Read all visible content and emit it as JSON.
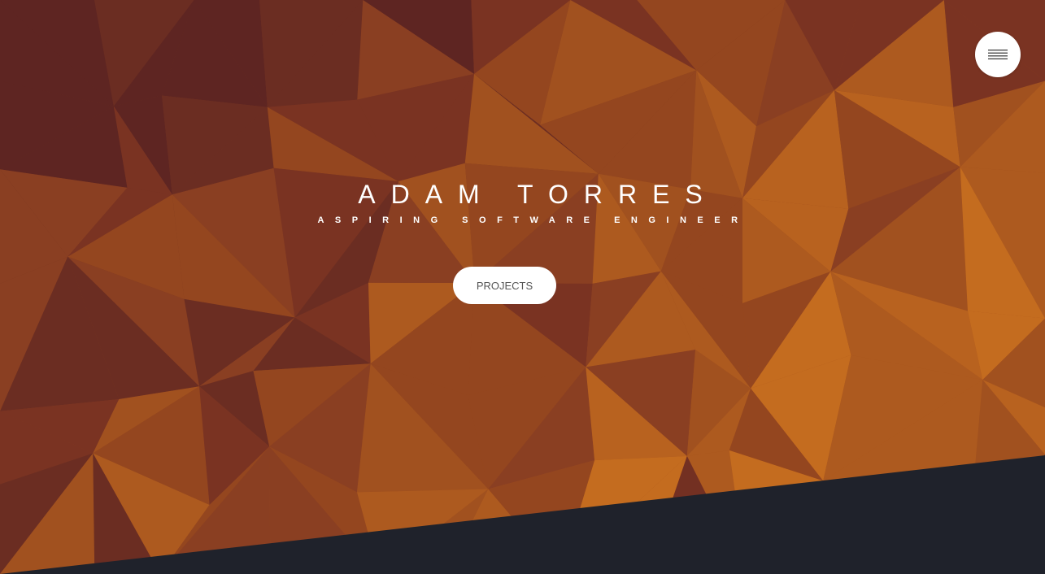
{
  "header": {
    "menu_icon": "hamburger-menu-icon"
  },
  "hero": {
    "title": "ADAM TORRES",
    "subtitle": "ASPIRING SOFTWARE ENGINEER",
    "projects_label": "PROJECTS"
  },
  "colors": {
    "accent_orange": "#b8551f",
    "dark_band": "#1f222b",
    "button_bg": "#ffffff",
    "button_text": "#555555"
  }
}
